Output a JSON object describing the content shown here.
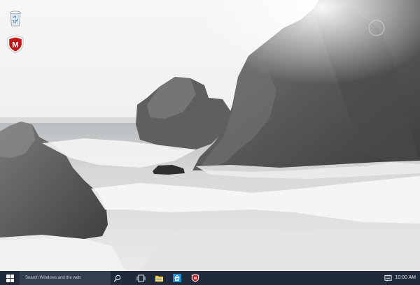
{
  "desktop": {
    "wallpaper": "rocky-seashore-waves",
    "icons": [
      {
        "name": "recycle-bin-icon"
      },
      {
        "name": "mcafee-icon",
        "glyph": "M",
        "color": "#c01818"
      }
    ]
  },
  "taskbar": {
    "color": "#1f2a3b",
    "search": {
      "placeholder": "Search Windows and the web"
    },
    "pinned": [
      {
        "name": "task-view-icon"
      },
      {
        "name": "file-explorer-icon",
        "color": "#f2c94c"
      },
      {
        "name": "store-icon",
        "color": "#1c8fd6"
      },
      {
        "name": "mcafee-icon",
        "color": "#c01818"
      }
    ],
    "clock": "10:00 AM"
  }
}
